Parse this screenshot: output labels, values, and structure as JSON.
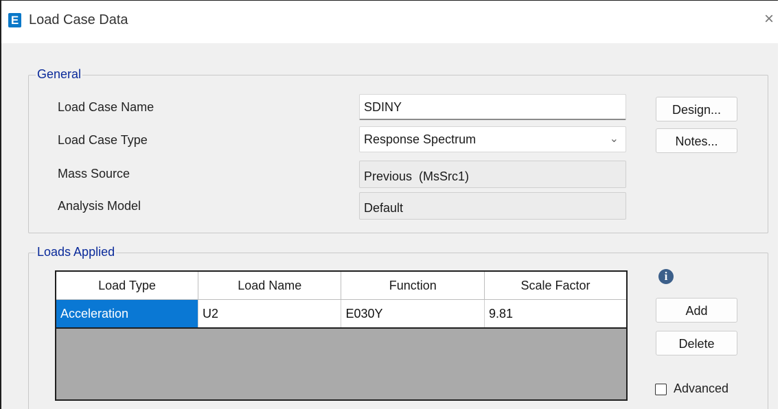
{
  "window": {
    "title": "Load Case Data",
    "app_icon_letter": "E",
    "close_glyph": "×"
  },
  "general": {
    "legend": "General",
    "load_case_name_label": "Load Case Name",
    "load_case_name_value": "SDINY",
    "load_case_type_label": "Load Case Type",
    "load_case_type_value": "Response Spectrum",
    "mass_source_label": "Mass Source",
    "mass_source_value": "Previous  (MsSrc1)",
    "analysis_model_label": "Analysis Model",
    "analysis_model_value": "Default",
    "design_button": "Design...",
    "notes_button": "Notes..."
  },
  "loads_applied": {
    "legend": "Loads Applied",
    "columns": [
      "Load Type",
      "Load Name",
      "Function",
      "Scale Factor"
    ],
    "rows": [
      [
        "Acceleration",
        "U2",
        "E030Y",
        "9.81"
      ]
    ],
    "add_button": "Add",
    "delete_button": "Delete",
    "advanced_label": "Advanced",
    "advanced_checked": false,
    "info_glyph": "i"
  },
  "colors": {
    "selection": "#0a78d4",
    "legend_text": "#0a2a9a",
    "grid_empty": "#aaaaaa"
  }
}
